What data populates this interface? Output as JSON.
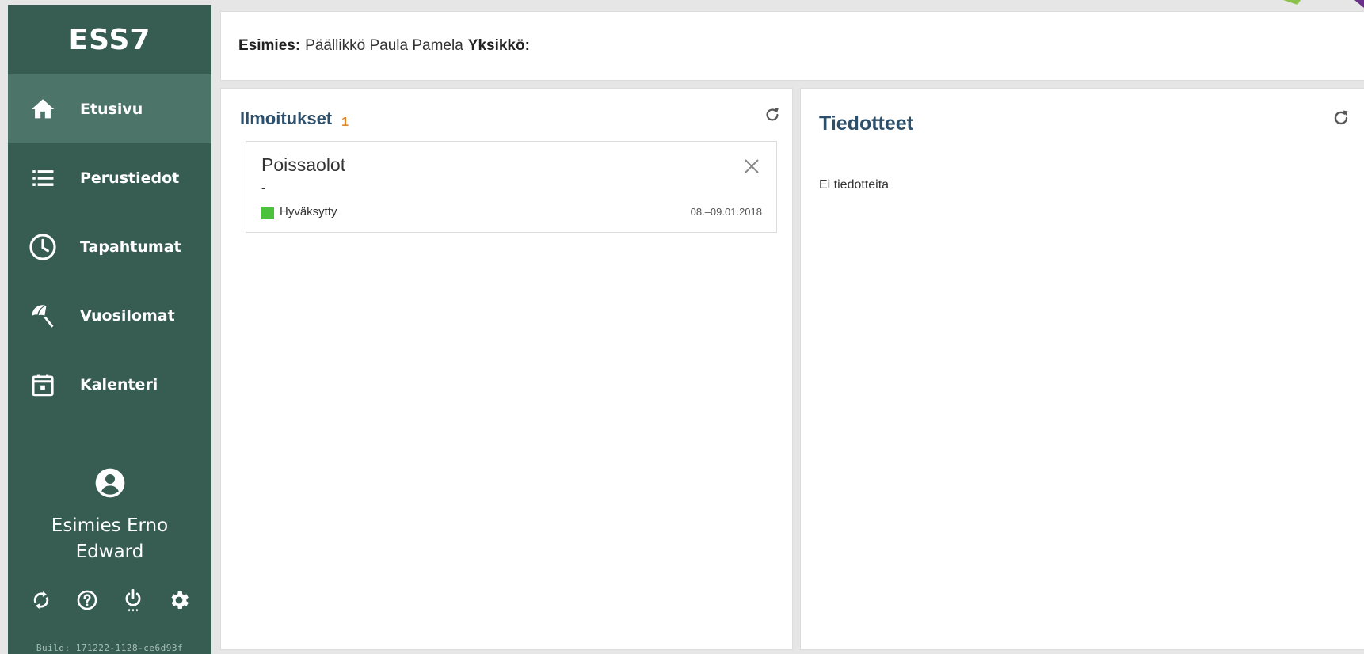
{
  "sidebar": {
    "app_title": "ESS7",
    "items": [
      {
        "label": "Etusivu",
        "icon": "home-icon",
        "active": true
      },
      {
        "label": "Perustiedot",
        "icon": "list-icon",
        "active": false
      },
      {
        "label": "Tapahtumat",
        "icon": "clock-icon",
        "active": false
      },
      {
        "label": "Vuosilomat",
        "icon": "beach-umbrella-icon",
        "active": false
      },
      {
        "label": "Kalenteri",
        "icon": "calendar-icon",
        "active": false
      }
    ],
    "user": {
      "name": "Esimies Erno Edward",
      "icon": "account-circle-icon"
    },
    "actions": [
      "sync-icon",
      "help-icon",
      "power-icon",
      "settings-icon"
    ],
    "build": "Build: 171222-1128-ce6d93f"
  },
  "header": {
    "supervisor_label": "Esimies:",
    "supervisor_value": "Päällikkö Paula Pamela",
    "unit_label": "Yksikkö:",
    "unit_value": ""
  },
  "notifications": {
    "title": "Ilmoitukset",
    "count": "1",
    "cards": [
      {
        "title": "Poissaolot",
        "subtitle": "-",
        "status": "Hyväksytty",
        "status_color": "#4cc13d",
        "date": "08.–09.01.2018"
      }
    ]
  },
  "bulletins": {
    "title": "Tiedotteet",
    "empty_text": "Ei tiedotteita"
  },
  "colors": {
    "sidebar_bg": "#375d52",
    "sidebar_active": "#4c7468",
    "title_blue": "#2d4f6a",
    "badge_orange": "#e0872a"
  }
}
